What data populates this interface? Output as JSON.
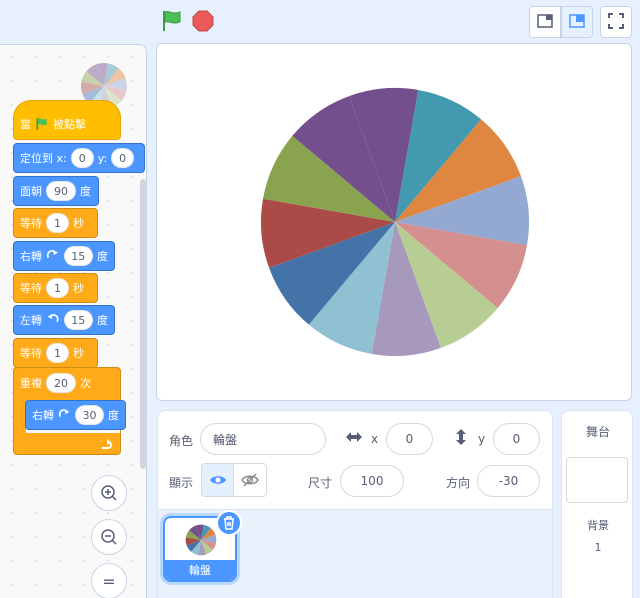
{
  "topbar": {
    "green_flag_icon": "green-flag-icon",
    "stop_icon": "stop-sign-icon",
    "layout_small_icon": "small-stage-icon",
    "layout_normal_icon": "normal-stage-icon",
    "fullscreen_icon": "fullscreen-icon"
  },
  "colors": {
    "motion": "#4c97ff",
    "events": "#ffbf00",
    "control": "#ffab19",
    "accent": "#4c97ff",
    "wheel": [
      "#744f8d",
      "#4399b0",
      "#df8740",
      "#93a9d1",
      "#d48f8f",
      "#b7cd94",
      "#a799bb",
      "#90c1d3",
      "#4473a8",
      "#ab4b47",
      "#8aa34e",
      "#744f8d"
    ]
  },
  "script": {
    "hat": {
      "prefix": "當",
      "suffix": "被點擊"
    },
    "goto": {
      "label": "定位到 x:",
      "x": "0",
      "y_label": "y:",
      "y": "0"
    },
    "point": {
      "label": "面朝",
      "value": "90",
      "unit": "度"
    },
    "wait1": {
      "label": "等待",
      "value": "1",
      "unit": "秒"
    },
    "turn_right1": {
      "label": "右轉",
      "value": "15",
      "unit": "度"
    },
    "wait2": {
      "label": "等待",
      "value": "1",
      "unit": "秒"
    },
    "turn_left": {
      "label": "左轉",
      "value": "15",
      "unit": "度"
    },
    "wait3": {
      "label": "等待",
      "value": "1",
      "unit": "秒"
    },
    "repeat": {
      "label": "重複",
      "value": "20",
      "unit": "次"
    },
    "turn_right2": {
      "label": "右轉",
      "value": "30",
      "unit": "度"
    }
  },
  "zoom": {
    "zoom_in_icon": "zoom-in-icon",
    "zoom_out_icon": "zoom-out-icon",
    "reset_label": "="
  },
  "sprite_info": {
    "sprite_label": "角色",
    "sprite_name": "輪盤",
    "x_label": "x",
    "x_value": "0",
    "y_label": "y",
    "y_value": "0",
    "show_label": "顯示",
    "size_label": "尺寸",
    "size_value": "100",
    "direction_label": "方向",
    "direction_value": "-30"
  },
  "sprites": [
    {
      "name": "輪盤"
    }
  ],
  "stage_panel": {
    "title": "舞台",
    "backdrops_label": "背景",
    "backdrops_count": "1"
  }
}
